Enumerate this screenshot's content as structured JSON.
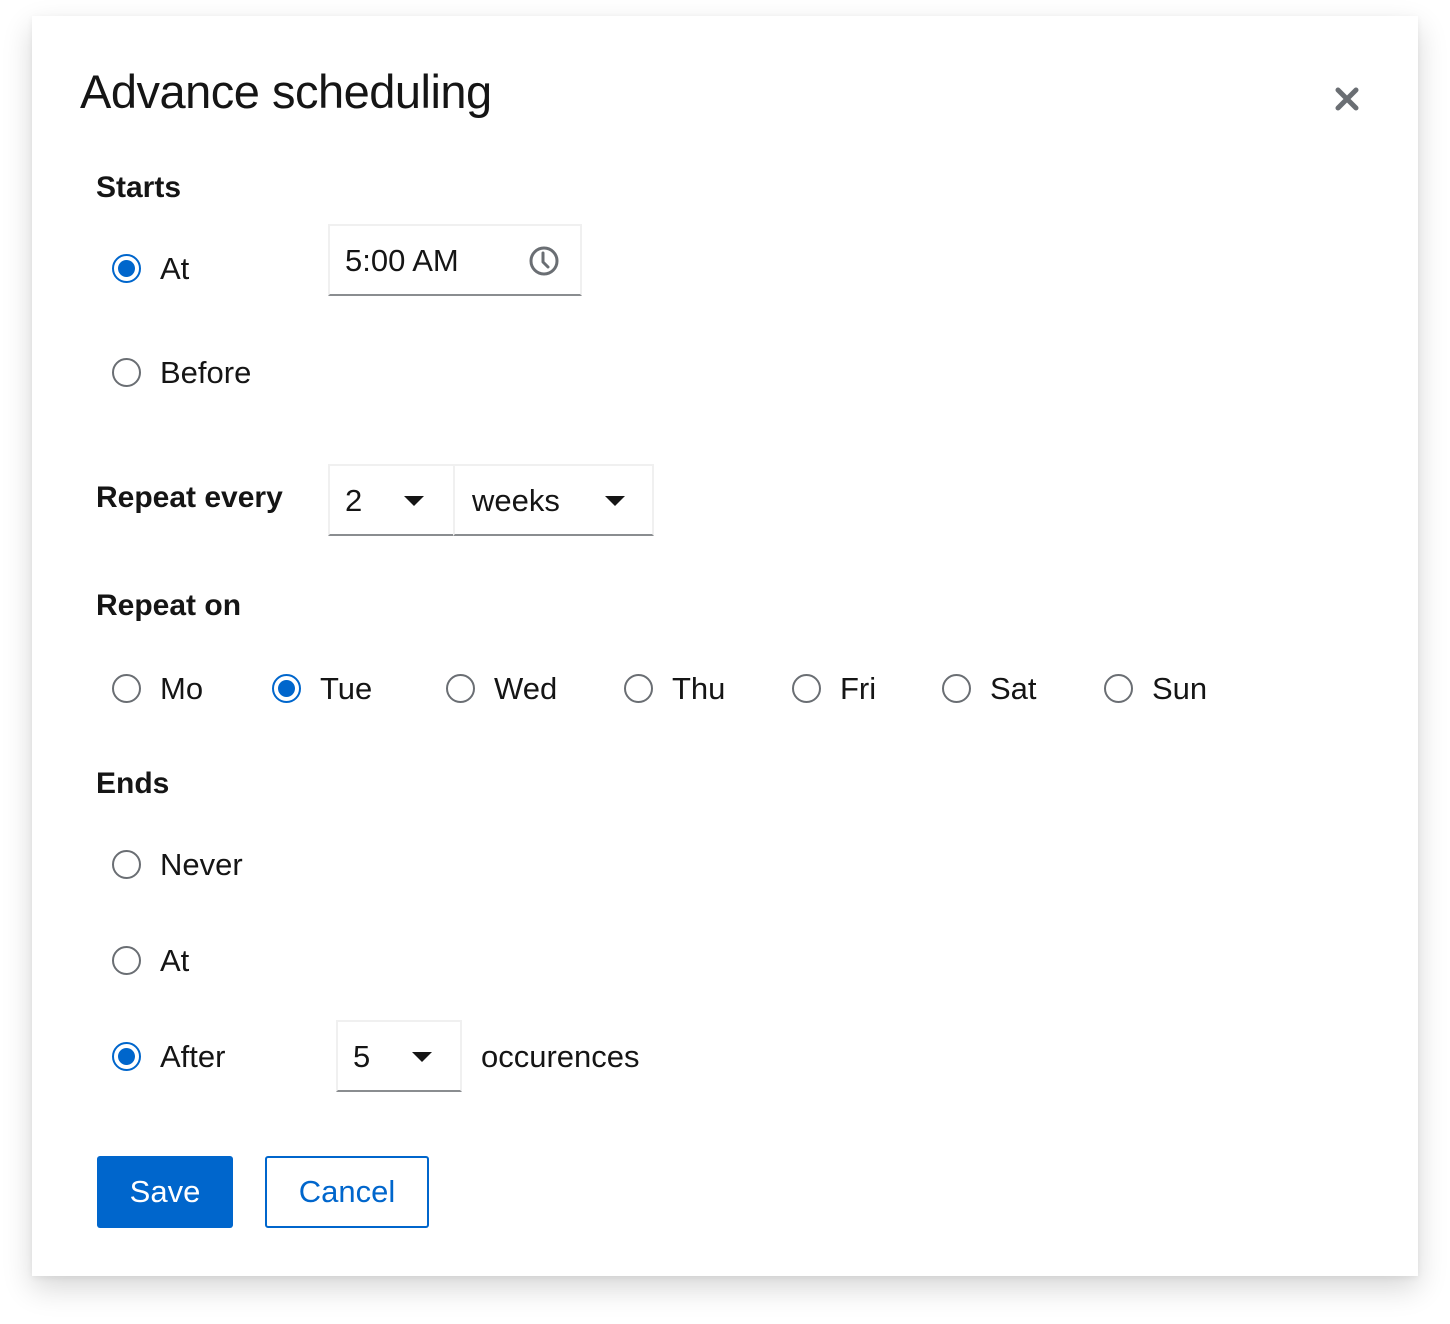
{
  "modal": {
    "title": "Advance scheduling",
    "close_icon": "close-icon"
  },
  "starts": {
    "label": "Starts",
    "options": [
      {
        "label": "At",
        "checked": true
      },
      {
        "label": "Before",
        "checked": false
      }
    ],
    "time_value": "5:00 AM",
    "time_icon": "clock-icon"
  },
  "repeat_every": {
    "label": "Repeat every",
    "interval_value": "2",
    "unit_value": "weeks"
  },
  "repeat_on": {
    "label": "Repeat on",
    "days": [
      {
        "label": "Mo",
        "checked": false
      },
      {
        "label": "Tue",
        "checked": true
      },
      {
        "label": "Wed",
        "checked": false
      },
      {
        "label": "Thu",
        "checked": false
      },
      {
        "label": "Fri",
        "checked": false
      },
      {
        "label": "Sat",
        "checked": false
      },
      {
        "label": "Sun",
        "checked": false
      }
    ]
  },
  "ends": {
    "label": "Ends",
    "options": [
      {
        "label": "Never",
        "checked": false
      },
      {
        "label": "At",
        "checked": false
      },
      {
        "label": "After",
        "checked": true
      }
    ],
    "occurrences_value": "5",
    "occurrences_suffix": "occurences"
  },
  "actions": {
    "save_label": "Save",
    "cancel_label": "Cancel"
  },
  "colors": {
    "accent": "#0066cc",
    "text": "#151515",
    "radio_border": "#6a6e73"
  }
}
